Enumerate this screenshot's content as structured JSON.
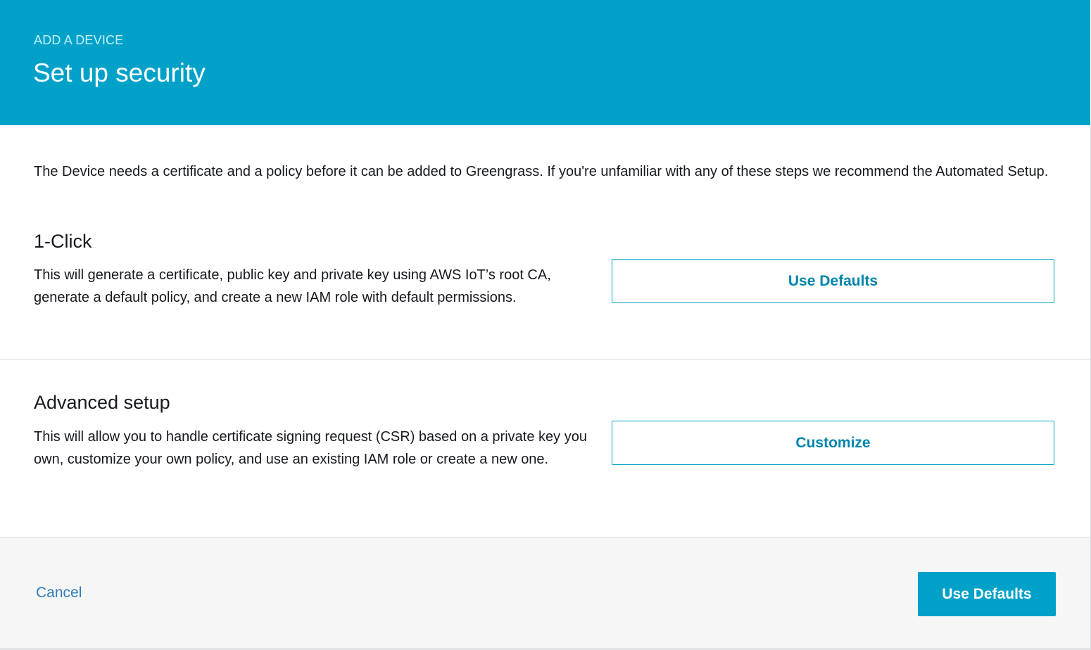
{
  "header": {
    "eyebrow": "ADD A DEVICE",
    "title": "Set up security"
  },
  "intro": {
    "text": "The Device needs a certificate and a policy before it can be added to Greengrass. If you're unfamiliar with any of these steps we recommend the Automated Setup."
  },
  "one_click": {
    "title": "1-Click",
    "description": "This will generate a certificate, public key and private key using AWS IoT’s root CA, generate a default policy, and create a new IAM role with default permissions.",
    "button_label": "Use Defaults"
  },
  "advanced": {
    "title": "Advanced setup",
    "description": "This will allow you to handle certificate signing request (CSR) based on a private key you own, customize your own policy, and use an existing IAM role or create a new one.",
    "button_label": "Customize"
  },
  "footer": {
    "cancel_label": "Cancel",
    "primary_label": "Use Defaults"
  },
  "colors": {
    "header_background": "#00a1c9",
    "eyebrow_text": "#c6f1fb",
    "accent": "#0085ad",
    "link": "#2f7dbd",
    "footer_background": "#f6f6f6"
  }
}
